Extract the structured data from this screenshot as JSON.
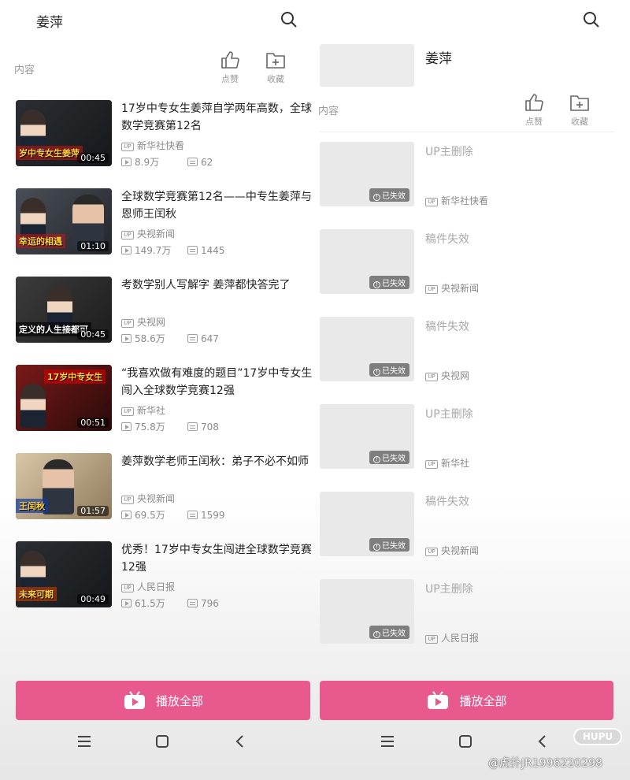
{
  "left": {
    "search_title": "姜萍",
    "section_label": "内容",
    "actions": {
      "like": "点赞",
      "favorite": "收藏"
    },
    "videos": [
      {
        "title": "17岁中专女生姜萍自学两年高数，全球数学竞赛第12名",
        "uploader": "新华社快看",
        "views": "8.9万",
        "danmaku": "62",
        "duration": "00:45",
        "thumb_caption": "岁中专女生姜萍"
      },
      {
        "title": "全球数学竞赛第12名——中专生姜萍与恩师王闰秋",
        "uploader": "央视新闻",
        "views": "149.7万",
        "danmaku": "1445",
        "duration": "01:10",
        "thumb_caption": "幸运的相遇"
      },
      {
        "title": "考数学别人写解字 姜萍都快答完了",
        "uploader": "央视网",
        "views": "58.6万",
        "danmaku": "647",
        "duration": "00:45",
        "thumb_caption": "定义的人生接都可"
      },
      {
        "title": "“我喜欢做有难度的题目”17岁中专女生闯入全球数学竞赛12强",
        "uploader": "新华社",
        "views": "75.8万",
        "danmaku": "708",
        "duration": "00:51",
        "thumb_caption": "17岁中专女生"
      },
      {
        "title": "姜萍数学老师王闰秋：弟子不必不如师",
        "uploader": "央视新闻",
        "views": "69.5万",
        "danmaku": "1599",
        "duration": "01:57",
        "thumb_caption": "王闰秋"
      },
      {
        "title": "优秀！17岁中专女生闯进全球数学竞赛12强",
        "uploader": "人民日报",
        "views": "61.5万",
        "danmaku": "796",
        "duration": "00:49",
        "thumb_caption": "未来可期"
      }
    ],
    "play_all": "播放全部"
  },
  "right": {
    "header_title": "姜萍",
    "section_label": "内容",
    "actions": {
      "like": "点赞",
      "favorite": "收藏"
    },
    "invalid_label": "已失效",
    "items": [
      {
        "status": "UP主删除",
        "uploader": "新华社快看"
      },
      {
        "status": "稿件失效",
        "uploader": "央视新闻"
      },
      {
        "status": "稿件失效",
        "uploader": "央视网"
      },
      {
        "status": "UP主删除",
        "uploader": "新华社"
      },
      {
        "status": "稿件失效",
        "uploader": "央视新闻"
      },
      {
        "status": "UP主删除",
        "uploader": "人民日报"
      }
    ],
    "play_all": "播放全部"
  },
  "overlay": {
    "logo_text": "HUPU",
    "watermark": "@虎扑JR1996220298"
  },
  "colors": {
    "accent": "#e85a8e",
    "muted_text": "#8a8a8a",
    "invalid_text": "#a8a8a8"
  }
}
